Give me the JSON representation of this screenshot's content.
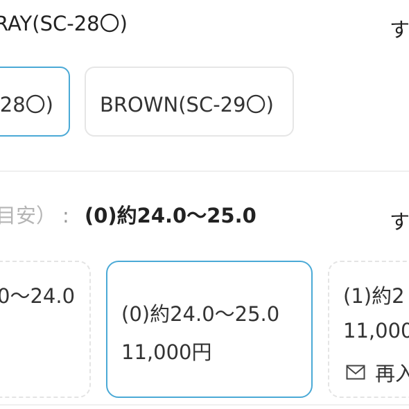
{
  "color_row": {
    "selected_text": "RAY(SC-28〇)",
    "more_link": "す",
    "options": [
      {
        "label": "28〇)",
        "selected": true
      },
      {
        "label": "BROWN(SC-29〇)",
        "selected": false
      }
    ]
  },
  "size_row": {
    "label": "目安）",
    "colon": ":",
    "selected_text": "(0)約24.0～25.0",
    "more_link": "す",
    "options": [
      {
        "name": "0～24.0",
        "price": "",
        "selected": false,
        "state": "unavailable"
      },
      {
        "name": "(0)約24.0～25.0",
        "price": "11,000円",
        "selected": true,
        "state": "available"
      },
      {
        "name": "(1)約2",
        "price": "11,000",
        "selected": false,
        "state": "restock",
        "restock_label": "再入"
      }
    ]
  },
  "colors": {
    "accent": "#4aa9d6",
    "border": "#e6e6e6",
    "muted_text": "#b5b5b5"
  },
  "icons": {
    "restock_icon": "mail-icon"
  }
}
